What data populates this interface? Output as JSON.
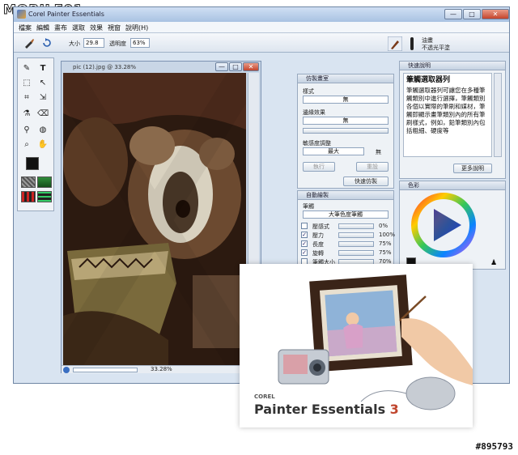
{
  "watermark": {
    "site": "MOBILE01",
    "post_id": "#895793"
  },
  "window": {
    "title": "Corel Painter Essentials",
    "minimize": "—",
    "maximize": "□",
    "close": "✕"
  },
  "menu": [
    "檔案",
    "編輯",
    "畫布",
    "選取",
    "效果",
    "視窗",
    "說明(H)"
  ],
  "propbar": {
    "size_label": "大小",
    "size_value": "29.8",
    "opacity_label": "透明度",
    "opacity_value": "63%",
    "brush_name_line1": "油畫",
    "brush_name_line2": "不透光平塗"
  },
  "document": {
    "title": "pic (12).jpg @ 33.28%",
    "zoom": "33.28%"
  },
  "clone_panel": {
    "title": "仿製畫室",
    "style_label": "樣式",
    "style_value": "無",
    "edge_label": "邊緣效果",
    "edge_value": "無",
    "sensitivity_label": "敏感度調整",
    "sensitivity_value": "最大",
    "sensitivity_end": "無",
    "btn_apply": "執行",
    "btn_reset": "重設",
    "btn_quick_clone": "快速仿製"
  },
  "brush_panel": {
    "title": "自動繪製",
    "brush_label": "筆觸",
    "brush_value": "大筆色度筆觸",
    "rows": [
      {
        "checked": false,
        "label": "壓感式",
        "value": "0%"
      },
      {
        "checked": true,
        "label": "壓力",
        "value": "100%"
      },
      {
        "checked": true,
        "label": "長度",
        "value": "75%"
      },
      {
        "checked": true,
        "label": "旋轉",
        "value": "75%"
      },
      {
        "checked": false,
        "label": "筆觸大小",
        "value": "70%"
      }
    ]
  },
  "tips_panel": {
    "title": "快速說明",
    "heading": "筆觸選取器列",
    "body": "筆觸選取器列可讓您在多種筆觸類別中進行選擇，筆觸類別各個以實際的筆刷和媒材，筆觸即顯示畫筆類別內的所有筆刷樣式，例如，鉛筆類別內包括粗細、硬度等",
    "more_btn": "更多說明"
  },
  "color_panel": {
    "title": "色彩"
  },
  "promo": {
    "brand_small": "COREL",
    "brand_main": "Painter Essentials",
    "brand_num": "3"
  },
  "colors": {
    "accent": "#2b3da6",
    "chrome": "#d9e4f1",
    "brand_red": "#c0452d"
  }
}
